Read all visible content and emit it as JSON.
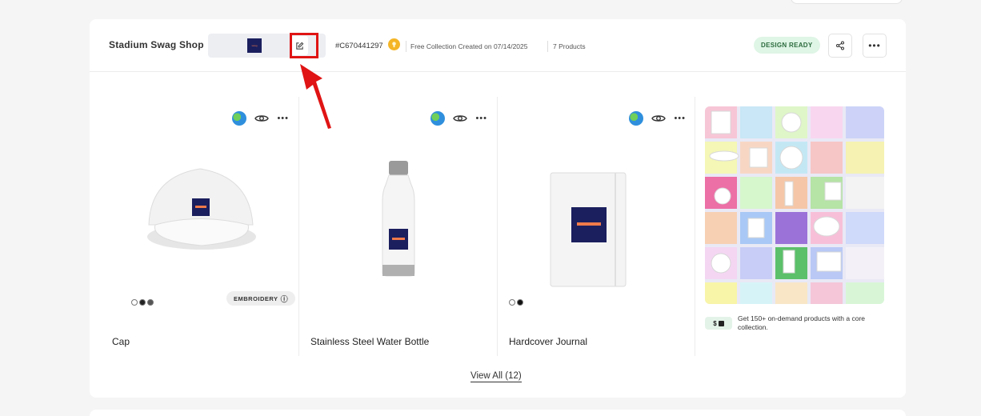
{
  "collection": {
    "shop_name": "Stadium Swag Shop",
    "id": "#C670441297",
    "created": "Free Collection Created on 07/14/2025",
    "count": "7 Products",
    "status": "DESIGN READY",
    "logo_text": "swag"
  },
  "products": [
    {
      "name": "Cap",
      "badge": "EMBROIDERY",
      "swatches": [
        "#ffffff",
        "#222222",
        "#555555"
      ]
    },
    {
      "name": "Stainless Steel Water Bottle",
      "badge": "",
      "swatches": []
    },
    {
      "name": "Hardcover Journal",
      "badge": "",
      "swatches": [
        "#ffffff",
        "#111111"
      ]
    }
  ],
  "promo": {
    "tag": "$",
    "text": "Get 150+ on-demand products with a core collection."
  },
  "view_all": "View All (12)",
  "colors": {
    "accent_red": "#e01414",
    "status_bg": "#dff5e6",
    "logo_navy": "#1b1f5e",
    "logo_orange": "#f07a4a"
  }
}
